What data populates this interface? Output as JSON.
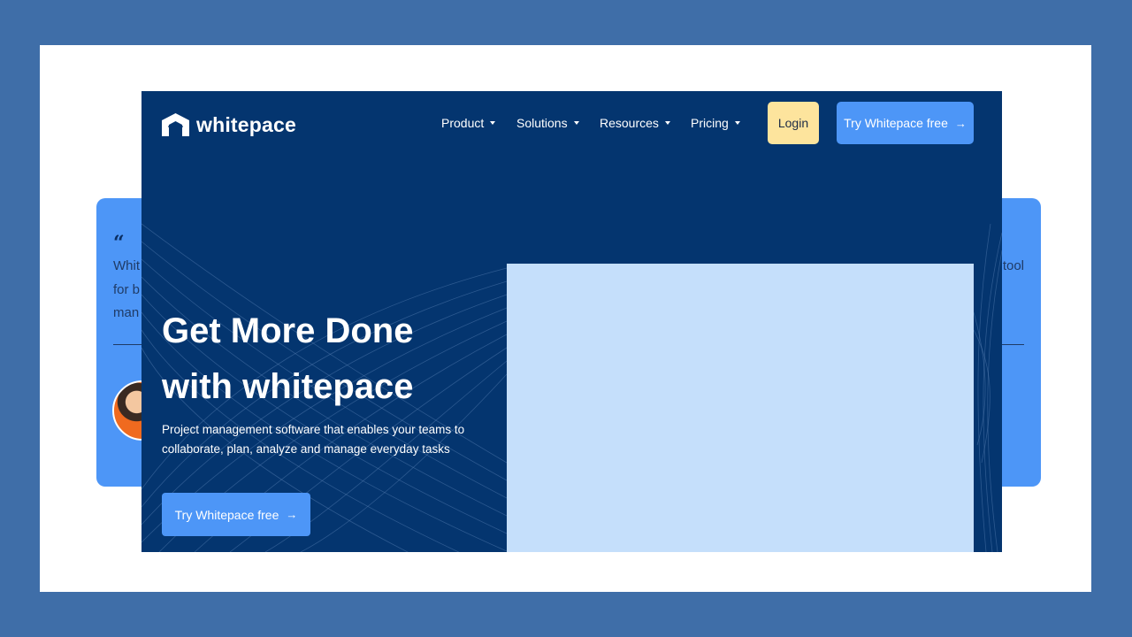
{
  "testimonial": {
    "quote_mark": "“",
    "line1_start": "Whit",
    "line1_end": "tool",
    "line2_start": "for b",
    "line3_start": "man"
  },
  "nav": {
    "logo_text": "whitepace",
    "items": [
      {
        "label": "Product"
      },
      {
        "label": "Solutions"
      },
      {
        "label": "Resources"
      },
      {
        "label": "Pricing"
      }
    ],
    "login_label": "Login",
    "try_label": "Try Whitepace free"
  },
  "hero": {
    "title_line1": "Get More Done",
    "title_line2": "with whitepace",
    "subtitle_line1": "Project management software that enables your teams to",
    "subtitle_line2": "collaborate, plan, analyze and manage everyday tasks",
    "cta_label": "Try Whitepace free"
  },
  "icons": {
    "arrow": "→"
  },
  "colors": {
    "page_bg": "#3f6ea8",
    "hero_bg": "#04356f",
    "accent_blue": "#4d96f7",
    "login_yellow": "#fde49d",
    "image_placeholder": "#c5dffb"
  }
}
